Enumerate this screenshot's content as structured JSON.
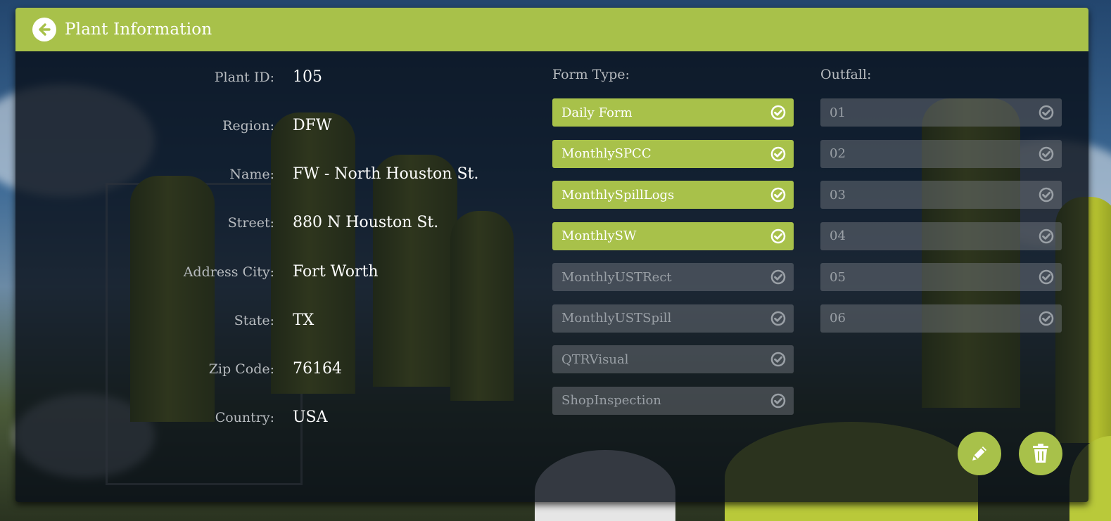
{
  "header": {
    "title": "Plant Information",
    "back_icon": "arrow-left-circle-icon"
  },
  "colors": {
    "accent": "#a8c14a",
    "panel": "#080e18",
    "muted": "#b8bcc0"
  },
  "fields": [
    {
      "label": "Plant ID:",
      "value": "105"
    },
    {
      "label": "Region:",
      "value": "DFW"
    },
    {
      "label": "Name:",
      "value": "FW - North Houston St."
    },
    {
      "label": "Street:",
      "value": "880 N Houston St."
    },
    {
      "label": "Address City:",
      "value": "Fort Worth"
    },
    {
      "label": "State:",
      "value": "TX"
    },
    {
      "label": "Zip Code:",
      "value": "76164"
    },
    {
      "label": "Country:",
      "value": "USA"
    }
  ],
  "form_type": {
    "title": "Form Type:",
    "options": [
      {
        "label": "Daily Form",
        "selected": true
      },
      {
        "label": "MonthlySPCC",
        "selected": true
      },
      {
        "label": "MonthlySpillLogs",
        "selected": true
      },
      {
        "label": "MonthlySW",
        "selected": true
      },
      {
        "label": "MonthlyUSTRect",
        "selected": false
      },
      {
        "label": "MonthlyUSTSpill",
        "selected": false
      },
      {
        "label": "QTRVisual",
        "selected": false
      },
      {
        "label": "ShopInspection",
        "selected": false
      }
    ]
  },
  "outfall": {
    "title": "Outfall:",
    "options": [
      {
        "label": "01",
        "selected": false
      },
      {
        "label": "02",
        "selected": false
      },
      {
        "label": "03",
        "selected": false
      },
      {
        "label": "04",
        "selected": false
      },
      {
        "label": "05",
        "selected": false
      },
      {
        "label": "06",
        "selected": false
      }
    ]
  },
  "actions": {
    "edit_icon": "pencil-icon",
    "delete_icon": "trash-icon"
  }
}
